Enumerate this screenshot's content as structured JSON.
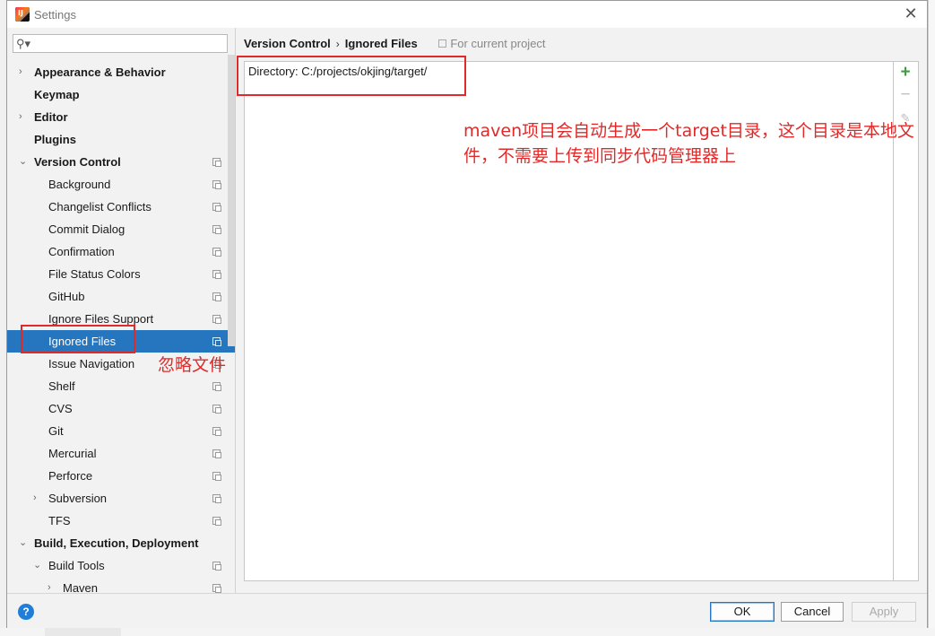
{
  "window": {
    "title": "Settings"
  },
  "search": {
    "placeholder": ""
  },
  "tree": [
    {
      "label": "Appearance & Behavior",
      "indent": 0,
      "arrow": "›",
      "bold": true
    },
    {
      "label": "Keymap",
      "indent": 0,
      "arrow": "",
      "bold": true
    },
    {
      "label": "Editor",
      "indent": 0,
      "arrow": "›",
      "bold": true
    },
    {
      "label": "Plugins",
      "indent": 0,
      "arrow": "",
      "bold": true
    },
    {
      "label": "Version Control",
      "indent": 0,
      "arrow": "⌄",
      "bold": true,
      "copy": true
    },
    {
      "label": "Background",
      "indent": 1,
      "arrow": "",
      "copy": true
    },
    {
      "label": "Changelist Conflicts",
      "indent": 1,
      "arrow": "",
      "copy": true
    },
    {
      "label": "Commit Dialog",
      "indent": 1,
      "arrow": "",
      "copy": true
    },
    {
      "label": "Confirmation",
      "indent": 1,
      "arrow": "",
      "copy": true
    },
    {
      "label": "File Status Colors",
      "indent": 1,
      "arrow": "",
      "copy": true
    },
    {
      "label": "GitHub",
      "indent": 1,
      "arrow": "",
      "copy": true
    },
    {
      "label": "Ignore Files Support",
      "indent": 1,
      "arrow": "",
      "copy": true
    },
    {
      "label": "Ignored Files",
      "indent": 1,
      "arrow": "",
      "copy": true,
      "selected": true
    },
    {
      "label": "Issue Navigation",
      "indent": 1,
      "arrow": "",
      "copy": true
    },
    {
      "label": "Shelf",
      "indent": 1,
      "arrow": "",
      "copy": true
    },
    {
      "label": "CVS",
      "indent": 1,
      "arrow": "",
      "copy": true
    },
    {
      "label": "Git",
      "indent": 1,
      "arrow": "",
      "copy": true
    },
    {
      "label": "Mercurial",
      "indent": 1,
      "arrow": "",
      "copy": true
    },
    {
      "label": "Perforce",
      "indent": 1,
      "arrow": "",
      "copy": true
    },
    {
      "label": "Subversion",
      "indent": 1,
      "arrow": "›",
      "copy": true
    },
    {
      "label": "TFS",
      "indent": 1,
      "arrow": "",
      "copy": true
    },
    {
      "label": "Build, Execution, Deployment",
      "indent": 0,
      "arrow": "⌄",
      "bold": true
    },
    {
      "label": "Build Tools",
      "indent": 1,
      "arrow": "⌄",
      "copy": true
    },
    {
      "label": "Maven",
      "indent": 2,
      "arrow": "›",
      "copy": true
    }
  ],
  "breadcrumb": {
    "parent": "Version Control",
    "separator": "›",
    "current": "Ignored Files",
    "scope": "For current project"
  },
  "ignored_list": {
    "items": [
      "Directory: C:/projects/okjing/target/"
    ]
  },
  "toolbar": {
    "add": "+",
    "remove": "−",
    "edit": "✎"
  },
  "annotations": {
    "list_note": "maven项目会自动生成一个target目录，这个目录是本地文件，不需要上传到同步代码管理器上",
    "tree_note": "忽略文件"
  },
  "buttons": {
    "ok": "OK",
    "cancel": "Cancel",
    "apply": "Apply",
    "help": "?"
  },
  "colors": {
    "selection": "#2675bf",
    "annotation": "#e02a2a",
    "add_icon": "#3c9f3c"
  }
}
